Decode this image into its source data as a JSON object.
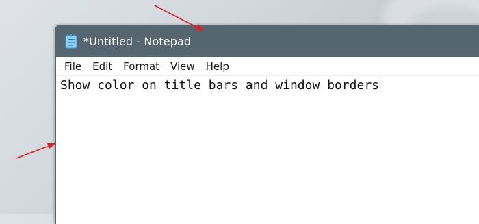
{
  "window": {
    "title": "*Untitled - Notepad",
    "icon": "notepad-icon",
    "accent_color": "#566670"
  },
  "menu": {
    "items": [
      {
        "label": "File"
      },
      {
        "label": "Edit"
      },
      {
        "label": "Format"
      },
      {
        "label": "View"
      },
      {
        "label": "Help"
      }
    ]
  },
  "editor": {
    "text": "Show color on title bars and window borders"
  },
  "annotations": {
    "arrow_color": "#e02020",
    "arrows": [
      "title-bar-arrow",
      "window-border-arrow"
    ]
  }
}
